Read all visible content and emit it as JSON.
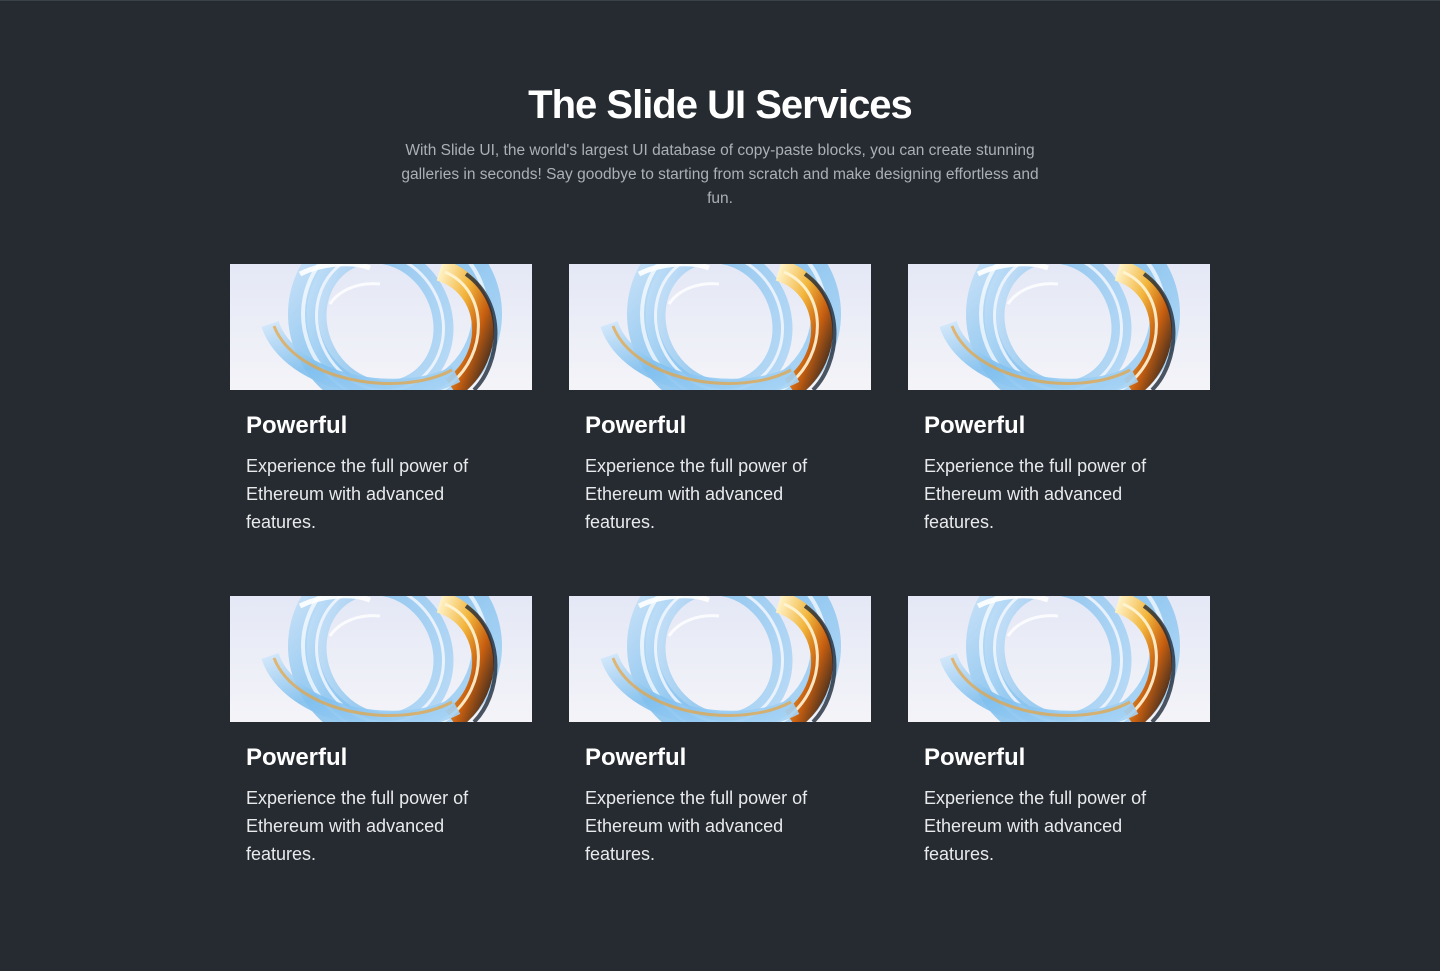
{
  "header": {
    "title": "The Slide UI Services",
    "subtitle": "With Slide UI, the world's largest UI database of copy-paste blocks, you can create stunning galleries in seconds! Say goodbye to starting from scratch and make designing effortless and fun."
  },
  "cards": [
    {
      "title": "Powerful",
      "description": "Experience the full power of Ethereum with advanced features.",
      "image_icon": "glass-ring-image"
    },
    {
      "title": "Powerful",
      "description": "Experience the full power of Ethereum with advanced features.",
      "image_icon": "glass-ring-image"
    },
    {
      "title": "Powerful",
      "description": "Experience the full power of Ethereum with advanced features.",
      "image_icon": "glass-ring-image"
    },
    {
      "title": "Powerful",
      "description": "Experience the full power of Ethereum with advanced features.",
      "image_icon": "glass-ring-image"
    },
    {
      "title": "Powerful",
      "description": "Experience the full power of Ethereum with advanced features.",
      "image_icon": "glass-ring-image"
    },
    {
      "title": "Powerful",
      "description": "Experience the full power of Ethereum with advanced features.",
      "image_icon": "glass-ring-image"
    }
  ],
  "colors": {
    "background": "#252b31",
    "title": "#ffffff",
    "subtitle": "#aab0b6",
    "card_text": "#e8eaec",
    "ring_blue": "#8cc8f0",
    "ring_gold": "#e8a020"
  }
}
